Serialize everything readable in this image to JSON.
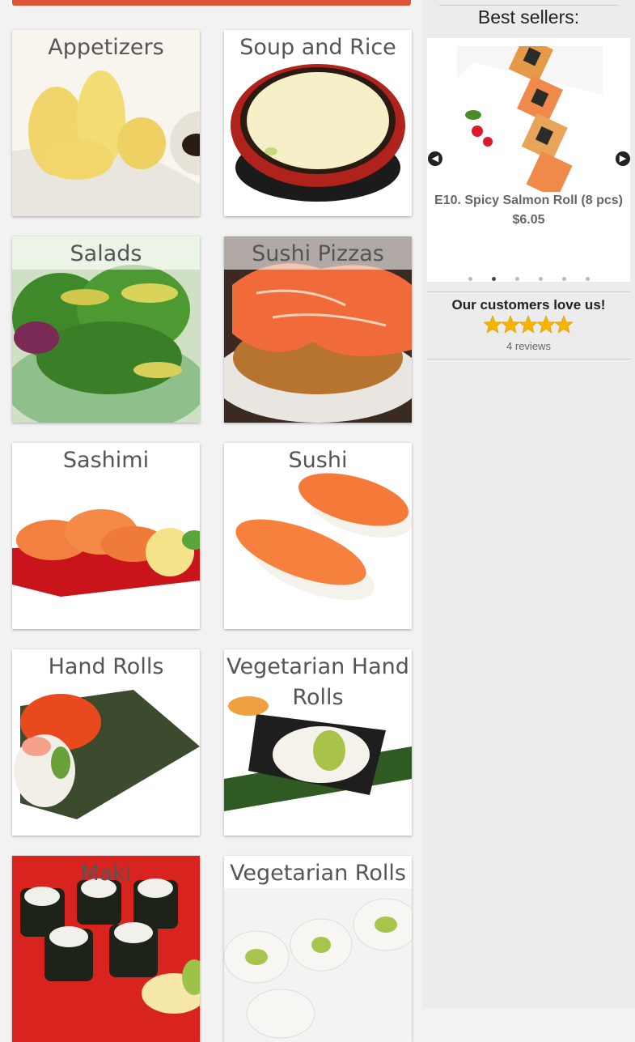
{
  "categories": [
    {
      "label": "Appetizers"
    },
    {
      "label": "Soup and Rice"
    },
    {
      "label": "Salads"
    },
    {
      "label": "Sushi Pizzas"
    },
    {
      "label": "Sashimi"
    },
    {
      "label": "Sushi"
    },
    {
      "label": "Hand Rolls"
    },
    {
      "label": "Vegetarian Hand Rolls"
    },
    {
      "label": "Maki"
    },
    {
      "label": "Vegetarian Rolls"
    }
  ],
  "sidebar": {
    "best_sellers_title": "Best sellers:",
    "carousel": {
      "item_name": "E10. Spicy Salmon Roll (8 pcs)",
      "item_price": "$6.05",
      "prev_icon": "chevron-left-icon",
      "next_icon": "chevron-right-icon",
      "dot_count": 6,
      "active_dot": 2
    },
    "reviews": {
      "heading": "Our customers love us!",
      "rating": 5,
      "count_text": "4 reviews"
    }
  },
  "colors": {
    "accent": "#e2543a",
    "star": "#f5b400"
  }
}
